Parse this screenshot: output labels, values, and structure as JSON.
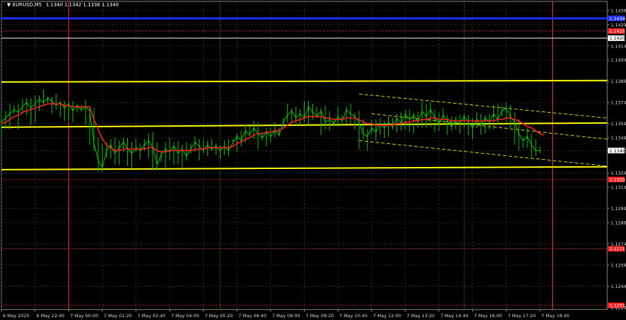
{
  "header": {
    "symbol": "EURUSD,M5",
    "quote": "1.1340 1.1342 1.1338 1.1340"
  },
  "chart_data": {
    "type": "line",
    "title": "EURUSD,M5 1.1340 1.1342 1.1338 1.1340",
    "ylim": [
      1.12275,
      1.14455
    ],
    "xlim": [
      0,
      144
    ],
    "grid": true,
    "y_ticks": [
      "1.1439",
      "1.1429",
      "1.1414",
      "1.1404",
      "1.1389",
      "1.1374",
      "1.1359",
      "1.1349",
      "1.1340",
      "1.1324",
      "1.1314",
      "1.1299",
      "1.1289",
      "1.1274",
      "1.1259",
      "1.1244",
      "1.1229"
    ],
    "x_ticks": [
      {
        "i": 0,
        "label": "6 May 2025"
      },
      {
        "i": 8,
        "label": "6 May 22:40"
      },
      {
        "i": 16,
        "label": "7 May 00:00"
      },
      {
        "i": 24,
        "label": "7 May 01:20"
      },
      {
        "i": 32,
        "label": "7 May 02:40"
      },
      {
        "i": 40,
        "label": "7 May 04:00"
      },
      {
        "i": 48,
        "label": "7 May 05:20"
      },
      {
        "i": 56,
        "label": "7 May 06:40"
      },
      {
        "i": 64,
        "label": "7 May 08:00"
      },
      {
        "i": 72,
        "label": "7 May 09:20"
      },
      {
        "i": 80,
        "label": "7 May 10:40"
      },
      {
        "i": 88,
        "label": "7 May 12:00"
      },
      {
        "i": 96,
        "label": "7 May 13:20"
      },
      {
        "i": 104,
        "label": "7 May 14:40"
      },
      {
        "i": 112,
        "label": "7 May 16:00"
      },
      {
        "i": 120,
        "label": "7 May 17:20"
      },
      {
        "i": 128,
        "label": "7 May 18:40"
      }
    ],
    "price_series": {
      "name": "EURUSD,M5",
      "color": "#00c800",
      "values": [
        1.136,
        1.1363,
        1.1366,
        1.1369,
        1.1367,
        1.1371,
        1.1374,
        1.137,
        1.1373,
        1.1376,
        1.1374,
        1.1377,
        1.1375,
        1.1372,
        1.1374,
        1.137,
        1.1373,
        1.1368,
        1.1372,
        1.1369,
        1.1371,
        1.1368,
        1.1345,
        1.1333,
        1.1328,
        1.134,
        1.1344,
        1.1338,
        1.1342,
        1.1346,
        1.1341,
        1.1338,
        1.1342,
        1.134,
        1.1344,
        1.1347,
        1.1342,
        1.133,
        1.1337,
        1.1341,
        1.1339,
        1.1343,
        1.1338,
        1.1341,
        1.1336,
        1.1341,
        1.1346,
        1.1343,
        1.134,
        1.1344,
        1.1341,
        1.1343,
        1.134,
        1.1343,
        1.134,
        1.1345,
        1.135,
        1.1347,
        1.1354,
        1.1351,
        1.1356,
        1.1352,
        1.1349,
        1.1353,
        1.135,
        1.1354,
        1.1351,
        1.136,
        1.1365,
        1.1368,
        1.1363,
        1.1366,
        1.1363,
        1.1371,
        1.1367,
        1.1364,
        1.1368,
        1.136,
        1.1362,
        1.1359,
        1.1364,
        1.1361,
        1.1369,
        1.1366,
        1.1364,
        1.136,
        1.1352,
        1.135,
        1.1356,
        1.1353,
        1.1359,
        1.1356,
        1.136,
        1.1357,
        1.1363,
        1.1359,
        1.1366,
        1.1362,
        1.1365,
        1.136,
        1.1368,
        1.1364,
        1.1369,
        1.1363,
        1.1359,
        1.1365,
        1.1361,
        1.1357,
        1.1362,
        1.1359,
        1.1364,
        1.136,
        1.1356,
        1.1362,
        1.1358,
        1.1363,
        1.136,
        1.1366,
        1.1362,
        1.1368,
        1.137,
        1.1364,
        1.136,
        1.1352,
        1.1347,
        1.135,
        1.1344,
        1.134,
        1.134
      ],
      "min_values": [
        1.1351,
        1.1355,
        1.1355,
        1.1366,
        1.1355,
        1.1366,
        1.1365,
        1.1358,
        1.136,
        1.1368,
        1.1372,
        1.1374,
        1.1366,
        1.1369,
        1.1364,
        1.1361,
        1.1362,
        1.136,
        1.1367,
        1.1367,
        1.1358,
        1.1344,
        1.134,
        1.1325,
        1.1325,
        1.1335,
        1.1334,
        1.133,
        1.133,
        1.1339,
        1.1329,
        1.1328,
        1.1339,
        1.1334,
        1.134,
        1.1335,
        1.1326,
        1.1326,
        1.1332,
        1.1328,
        1.1333,
        1.133,
        1.133,
        1.1328,
        1.1333,
        1.1338,
        1.1339,
        1.1333,
        1.1338,
        1.1336,
        1.134,
        1.1337,
        1.1334,
        1.1337,
        1.1336,
        1.1346,
        1.1339,
        1.1343,
        1.1346,
        1.135,
        1.1348,
        1.1341,
        1.1347,
        1.1343,
        1.1346,
        1.1349,
        1.135,
        1.1357,
        1.136,
        1.1359,
        1.1359,
        1.1358,
        1.136,
        1.1358,
        1.1362,
        1.1363,
        1.1351,
        1.1355,
        1.1354,
        1.1357,
        1.1357,
        1.1358,
        1.1359,
        1.1359,
        1.1355,
        1.1341,
        1.1348,
        1.134,
        1.1352,
        1.1347,
        1.1351,
        1.1349,
        1.135,
        1.1355,
        1.1353,
        1.1354,
        1.1355,
        1.1353,
        1.1352,
        1.1356,
        1.1356,
        1.1356,
        1.1357,
        1.1353,
        1.1354,
        1.1359,
        1.1351,
        1.1354,
        1.1355,
        1.1352,
        1.1356,
        1.1351,
        1.1348,
        1.1356,
        1.1351,
        1.1352,
        1.1355,
        1.1355,
        1.1358,
        1.1364,
        1.136,
        1.1356,
        1.1344,
        1.134,
        1.1342,
        1.1342,
        1.1335,
        1.1336,
        1.1338,
        1.1338
      ],
      "max_values": [
        1.1369,
        1.1368,
        1.1373,
        1.1372,
        1.1373,
        1.1377,
        1.1377,
        1.1377,
        1.1379,
        1.1379,
        1.1383,
        1.1378,
        1.1378,
        1.138,
        1.1375,
        1.1375,
        1.1374,
        1.1375,
        1.1373,
        1.1372,
        1.1376,
        1.1371,
        1.137,
        1.1349,
        1.1345,
        1.1346,
        1.1348,
        1.1349,
        1.1347,
        1.1349,
        1.1349,
        1.1346,
        1.1348,
        1.1345,
        1.1348,
        1.1352,
        1.1353,
        1.1346,
        1.1339,
        1.1346,
        1.1349,
        1.1346,
        1.1347,
        1.1344,
        1.1346,
        1.1345,
        1.135,
        1.1348,
        1.1348,
        1.1347,
        1.1348,
        1.1345,
        1.1344,
        1.1347,
        1.1348,
        1.1348,
        1.1352,
        1.1354,
        1.1358,
        1.1357,
        1.1361,
        1.136,
        1.1353,
        1.1356,
        1.1356,
        1.136,
        1.1356,
        1.1363,
        1.1373,
        1.137,
        1.1371,
        1.1369,
        1.1375,
        1.1375,
        1.1373,
        1.1371,
        1.137,
        1.1372,
        1.1368,
        1.1363,
        1.1371,
        1.1365,
        1.1371,
        1.1373,
        1.1367,
        1.1368,
        1.1362,
        1.1355,
        1.1362,
        1.1362,
        1.1363,
        1.1361,
        1.1364,
        1.1363,
        1.1366,
        1.1367,
        1.1369,
        1.1369,
        1.1367,
        1.1367,
        1.1375,
        1.1373,
        1.1374,
        1.1369,
        1.1367,
        1.137,
        1.1365,
        1.1364,
        1.1364,
        1.1365,
        1.1366,
        1.1365,
        1.1363,
        1.1367,
        1.1366,
        1.1365,
        1.1366,
        1.1372,
        1.1373,
        1.1372,
        1.1374,
        1.1372,
        1.1367,
        1.1362,
        1.1349,
        1.1356,
        1.1352,
        1.1348,
        1.1343,
        1.1343
      ]
    },
    "moving_average": {
      "color": "#ff2020",
      "values": [
        1.1359,
        1.136,
        1.1362,
        1.1364,
        1.1365,
        1.1367,
        1.1368,
        1.1369,
        1.137,
        1.1371,
        1.1372,
        1.1373,
        1.1373,
        1.1373,
        1.1373,
        1.1372,
        1.1372,
        1.1371,
        1.1371,
        1.1371,
        1.1371,
        1.1371,
        1.1362,
        1.1355,
        1.1348,
        1.1344,
        1.1342,
        1.134,
        1.134,
        1.1341,
        1.1341,
        1.1341,
        1.1341,
        1.1341,
        1.1341,
        1.1342,
        1.1342,
        1.134,
        1.1339,
        1.1339,
        1.134,
        1.134,
        1.134,
        1.134,
        1.134,
        1.134,
        1.1341,
        1.1341,
        1.1341,
        1.1342,
        1.1342,
        1.1342,
        1.1342,
        1.1342,
        1.1342,
        1.1343,
        1.1345,
        1.1346,
        1.1348,
        1.1349,
        1.1351,
        1.1352,
        1.1352,
        1.1353,
        1.1353,
        1.1354,
        1.1354,
        1.1356,
        1.1358,
        1.136,
        1.1361,
        1.1362,
        1.1363,
        1.1364,
        1.1364,
        1.1364,
        1.1364,
        1.1363,
        1.1363,
        1.1362,
        1.1362,
        1.1362,
        1.1363,
        1.1363,
        1.1363,
        1.1362,
        1.136,
        1.1359,
        1.1359,
        1.1358,
        1.1358,
        1.1358,
        1.1358,
        1.1358,
        1.1359,
        1.1359,
        1.136,
        1.136,
        1.1361,
        1.1361,
        1.1362,
        1.1362,
        1.1363,
        1.1363,
        1.1362,
        1.1362,
        1.1362,
        1.1361,
        1.1361,
        1.1361,
        1.1361,
        1.1361,
        1.1361,
        1.1361,
        1.1361,
        1.1361,
        1.1361,
        1.1361,
        1.1362,
        1.1362,
        1.1363,
        1.1363,
        1.1362,
        1.1361,
        1.1359,
        1.1357,
        1.1356,
        1.1354,
        1.1352,
        1.1351
      ]
    },
    "horizontal_lines": [
      {
        "name": "blue-level-line",
        "y": 1.14335,
        "color": "#1e32ff",
        "width": 3,
        "style": "solid"
      },
      {
        "name": "red-level-line",
        "y": 1.14245,
        "color": "#ff3030",
        "width": 1,
        "style": "dotted"
      },
      {
        "name": "white-level-line",
        "y": 1.14195,
        "color": "#ffffff",
        "width": 1,
        "style": "solid"
      },
      {
        "name": "red-level-line",
        "y": 1.13195,
        "color": "#ff3030",
        "width": 1,
        "style": "dotted"
      },
      {
        "name": "red-level-line",
        "y": 1.12705,
        "color": "#ff3030",
        "width": 1,
        "style": "dotted"
      },
      {
        "name": "red-level-line",
        "y": 1.12305,
        "color": "#ff3030",
        "width": 1,
        "style": "dotted"
      }
    ],
    "trend_lines": [
      {
        "name": "yellow-channel-top",
        "from": [
          0,
          1.13885
        ],
        "to": [
          144,
          1.13895
        ],
        "color": "#ffff00",
        "width": 2,
        "style": "solid"
      },
      {
        "name": "yellow-channel-middle",
        "from": [
          0,
          1.13565
        ],
        "to": [
          144,
          1.13595
        ],
        "color": "#ffff00",
        "width": 2,
        "style": "solid"
      },
      {
        "name": "yellow-channel-bottom",
        "from": [
          0,
          1.13265
        ],
        "to": [
          144,
          1.13285
        ],
        "color": "#ffff00",
        "width": 2,
        "style": "solid"
      },
      {
        "name": "dashed-trend-upper",
        "from": [
          85,
          1.138
        ],
        "to": [
          144,
          1.1363
        ],
        "color": "#dcdc00",
        "width": 1,
        "style": "dashed"
      },
      {
        "name": "dashed-trend-middle",
        "from": [
          88,
          1.1366
        ],
        "to": [
          144,
          1.1348
        ],
        "color": "#dcdc00",
        "width": 1,
        "style": "dashed"
      },
      {
        "name": "dashed-trend-lower",
        "from": [
          85,
          1.1347
        ],
        "to": [
          144,
          1.1329
        ],
        "color": "#dcdc00",
        "width": 1,
        "style": "dashed"
      }
    ],
    "vertical_lines": [
      {
        "name": "red-session-line",
        "x": 16,
        "color": "#ff3030",
        "style": "solid"
      },
      {
        "name": "red-session-line",
        "x": 131,
        "color": "#ff3030",
        "style": "solid"
      },
      {
        "name": "green-session-line",
        "x": 52,
        "color": "#2aa02a",
        "style": "dotted"
      },
      {
        "name": "green-session-line",
        "x": 110,
        "color": "#2aa02a",
        "style": "dotted"
      }
    ],
    "price_tags": [
      {
        "name": "price-tag-1.1434",
        "y": 1.14335,
        "text": "1.1434",
        "bg": "#1e32ff",
        "fg": "#ffffff"
      },
      {
        "name": "price-tag-1.1425",
        "y": 1.14245,
        "text": "1.1425",
        "bg": "#ff2020",
        "fg": "#ffffff"
      },
      {
        "name": "price-tag-1.1420",
        "y": 1.14195,
        "text": "1.1420",
        "bg": "#ffffff",
        "fg": "#000000"
      },
      {
        "name": "price-tag-current",
        "y": 1.134,
        "text": "1.1340",
        "bg": "#ffffff",
        "fg": "#000000"
      },
      {
        "name": "price-tag-1.1320",
        "y": 1.13195,
        "text": "1.1320",
        "bg": "#ff2020",
        "fg": "#ffffff"
      },
      {
        "name": "price-tag-1.1271",
        "y": 1.12705,
        "text": "1.1271",
        "bg": "#ff2020",
        "fg": "#ffffff"
      },
      {
        "name": "price-tag-1.1231",
        "y": 1.12305,
        "text": "1.1231",
        "bg": "#ff2020",
        "fg": "#ffffff"
      }
    ]
  }
}
